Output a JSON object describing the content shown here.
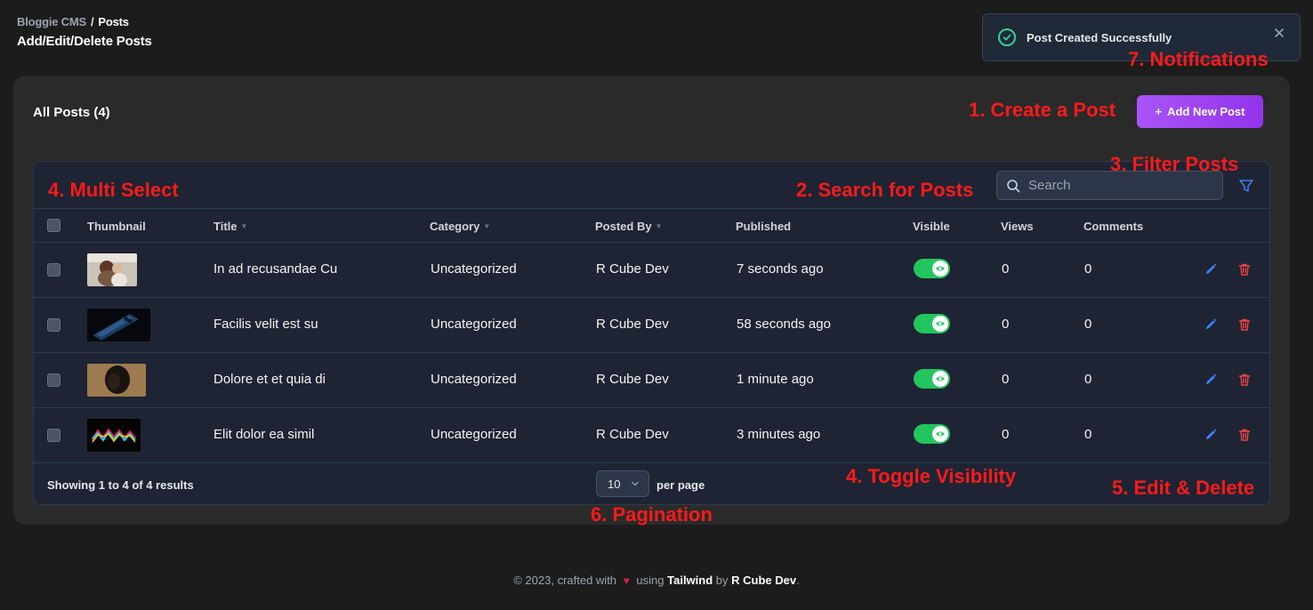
{
  "breadcrumb": {
    "root": "Bloggie CMS",
    "separator": "/",
    "current": "Posts"
  },
  "page_title": "Add/Edit/Delete Posts",
  "toast": {
    "message": "Post Created Successfully",
    "close_glyph": "×",
    "status_color": "#34d399"
  },
  "card": {
    "title": "All Posts (4)",
    "add_button": {
      "icon": "+",
      "label": "Add New Post"
    }
  },
  "search": {
    "placeholder": "Search",
    "value": ""
  },
  "table": {
    "columns": {
      "thumbnail": "Thumbnail",
      "title": "Title",
      "category": "Category",
      "posted_by": "Posted By",
      "published": "Published",
      "visible": "Visible",
      "views": "Views",
      "comments": "Comments"
    },
    "rows": [
      {
        "title": "In ad recusandae Cu",
        "category": "Uncategorized",
        "posted_by": "R Cube Dev",
        "published": "7 seconds ago",
        "visible": true,
        "views": "0",
        "comments": "0"
      },
      {
        "title": "Facilis velit est su",
        "category": "Uncategorized",
        "posted_by": "R Cube Dev",
        "published": "58 seconds ago",
        "visible": true,
        "views": "0",
        "comments": "0"
      },
      {
        "title": "Dolore et et quia di",
        "category": "Uncategorized",
        "posted_by": "R Cube Dev",
        "published": "1 minute ago",
        "visible": true,
        "views": "0",
        "comments": "0"
      },
      {
        "title": "Elit dolor ea simil",
        "category": "Uncategorized",
        "posted_by": "R Cube Dev",
        "published": "3 minutes ago",
        "visible": true,
        "views": "0",
        "comments": "0"
      }
    ],
    "showing": "Showing 1 to 4 of 4 results",
    "per_page_value": "10",
    "per_page_label": "per page"
  },
  "annotations": {
    "create": "1. Create a Post",
    "search": "2. Search for Posts",
    "filter": "3. Filter Posts",
    "multi_select": "4. Multi Select",
    "toggle": "4. Toggle Visibility",
    "edit_delete": "5. Edit & Delete",
    "pagination": "6. Pagination",
    "notifications": "7. Notifications"
  },
  "footer": {
    "prefix": "© 2023, crafted with",
    "using": "using",
    "framework": "Tailwind",
    "by": "by",
    "author": "R Cube Dev",
    "suffix": "."
  },
  "colors": {
    "accent": "#a855f7",
    "toggle_on": "#22c55e",
    "edit": "#3b82f6",
    "delete": "#ef4444",
    "annotation": "#ff1a1a"
  }
}
